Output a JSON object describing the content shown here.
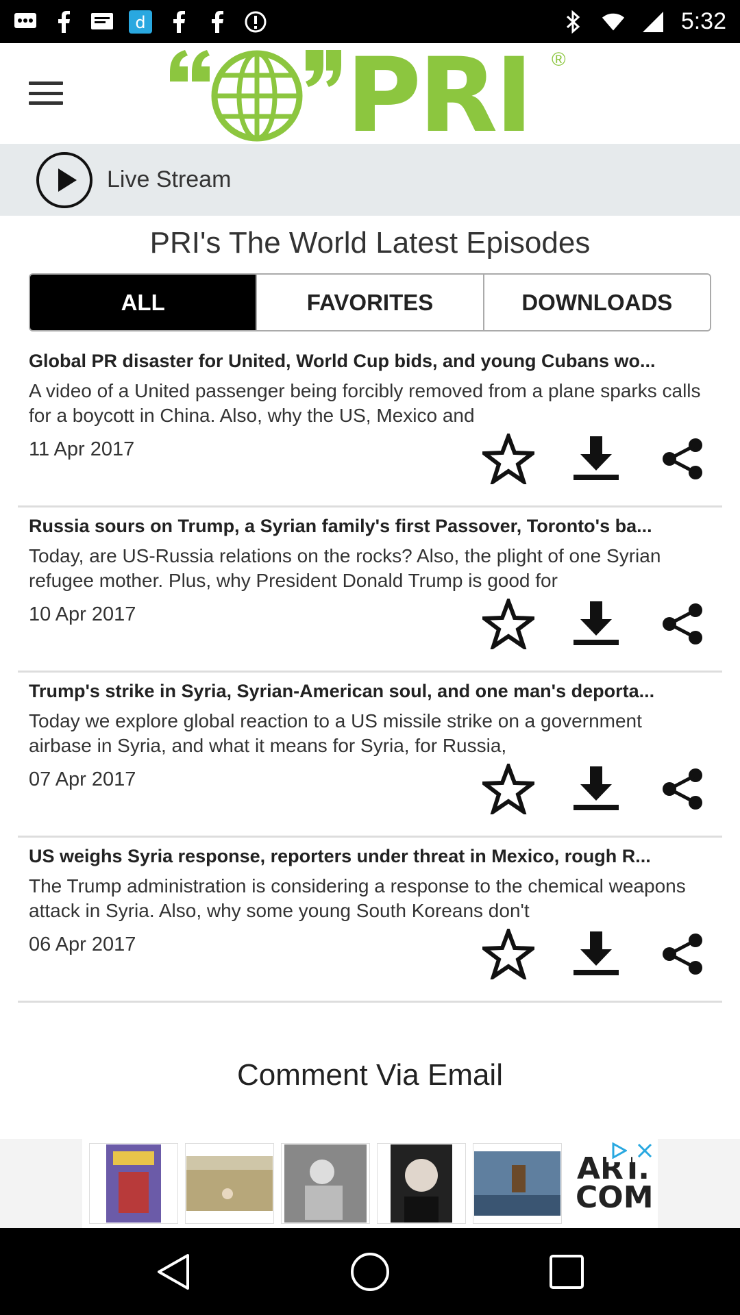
{
  "status_bar": {
    "time": "5:32",
    "left_icons": [
      "chat-icon",
      "facebook-icon",
      "message-icon",
      "dictionary-icon",
      "facebook-icon",
      "facebook-icon",
      "alert-icon"
    ],
    "right_icons": [
      "bluetooth-icon",
      "wifi-icon",
      "signal-icon"
    ]
  },
  "header": {
    "logo_text": "PRI",
    "logo_reg": "®",
    "brand_color": "#8cc63f"
  },
  "live_stream": {
    "label": "Live Stream"
  },
  "section": {
    "title": "PRI's The World Latest Episodes"
  },
  "tabs": [
    {
      "label": "ALL",
      "active": true
    },
    {
      "label": "FAVORITES",
      "active": false
    },
    {
      "label": "DOWNLOADS",
      "active": false
    }
  ],
  "episodes": [
    {
      "title": "Global PR disaster for United, World Cup bids, and young Cubans wo...",
      "description": "A video of a United passenger being forcibly removed from a plane sparks calls for a boycott in China. Also, why the US, Mexico and",
      "date": "11 Apr 2017"
    },
    {
      "title": "Russia sours on Trump, a Syrian family's first Passover, Toronto's ba...",
      "description": "Today, are US-Russia relations on the rocks? Also, the plight of one Syrian refugee mother. Plus, why President Donald Trump is good for",
      "date": "10 Apr 2017"
    },
    {
      "title": "Trump's strike in Syria, Syrian-American soul, and one man's deporta...",
      "description": "Today we explore global reaction to a US missile strike on a government airbase in Syria, and what it means for Syria, for Russia,",
      "date": "07 Apr 2017"
    },
    {
      "title": "US weighs Syria response, reporters under threat in Mexico, rough R...",
      "description": "The Trump administration is considering a response to the chemical weapons attack in Syria. Also, why some young South Koreans don't",
      "date": "06 Apr 2017"
    }
  ],
  "comment": {
    "label": "Comment Via Email"
  },
  "ad": {
    "brand": "ART. COM",
    "thumbnails": [
      "1985-poster",
      "landscape-painting",
      "marilyn-photo",
      "marilyn-portrait",
      "ship-painting"
    ]
  },
  "nav_bar": {
    "buttons": [
      "back-icon",
      "home-icon",
      "recents-icon"
    ]
  }
}
